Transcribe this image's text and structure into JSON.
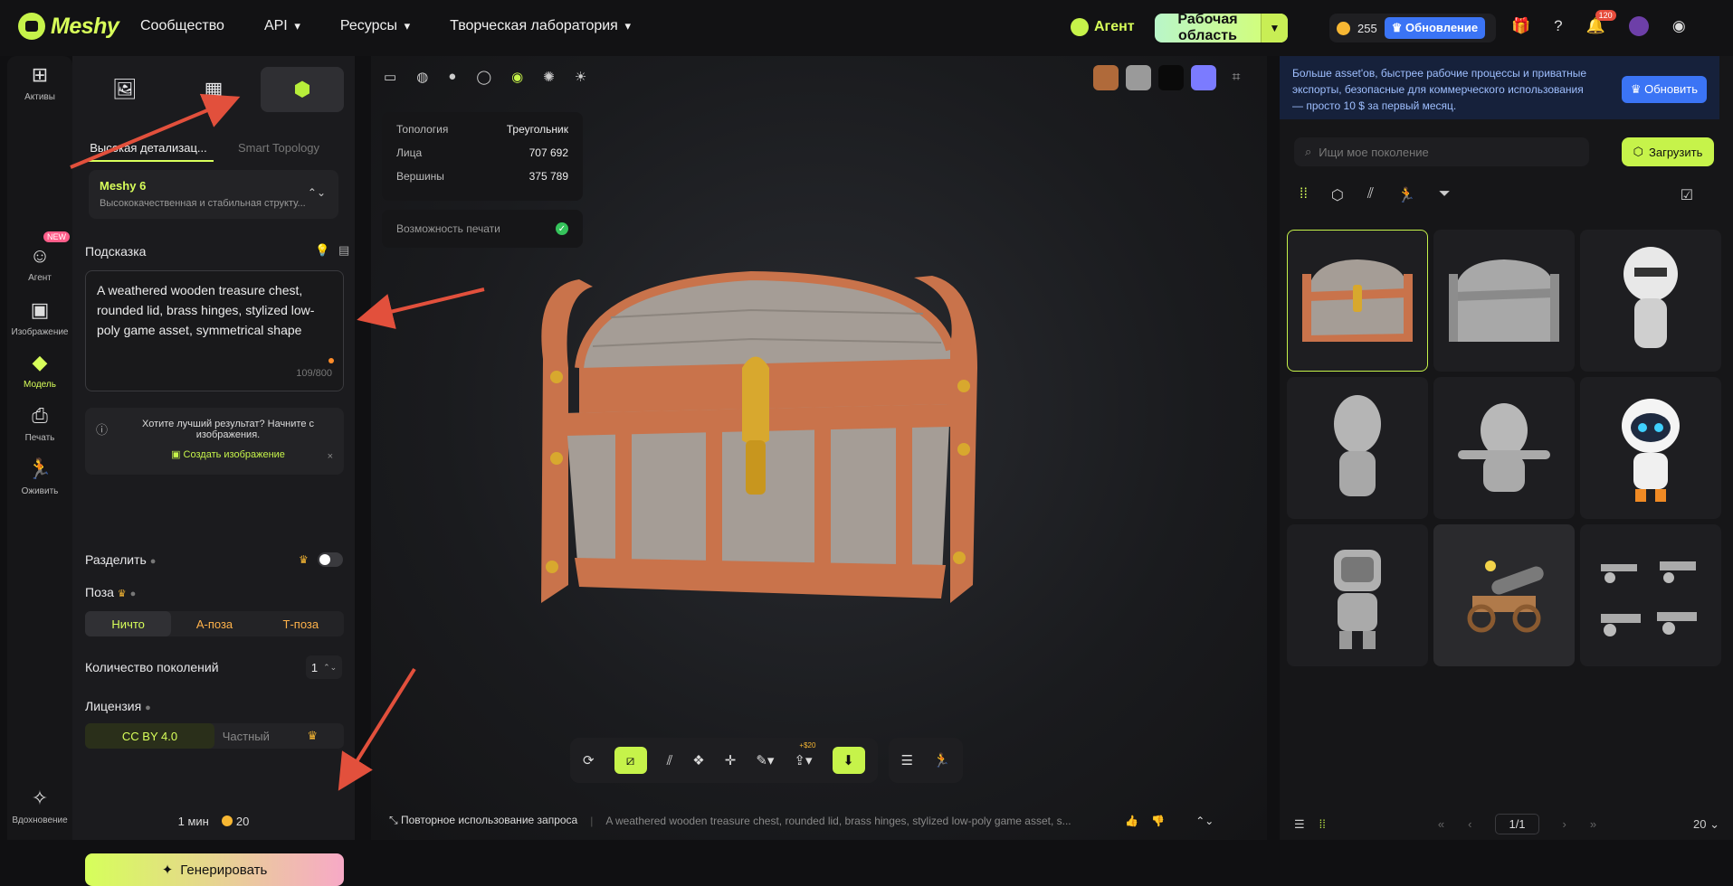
{
  "app": {
    "logo_text": "Meshy"
  },
  "nav": {
    "items": [
      "Сообщество",
      "API",
      "Ресурсы",
      "Творческая лаборатория"
    ]
  },
  "top": {
    "agent_label": "Агент",
    "workspace_label": "Рабочая область",
    "credits": "255",
    "upgrade_label": "Обновление",
    "notif_count": "120"
  },
  "rail": {
    "items": [
      {
        "label": "Активы"
      },
      {
        "label": "Агент",
        "badge": "NEW"
      },
      {
        "label": "Изображение"
      },
      {
        "label": "Модель"
      },
      {
        "label": "Печать"
      },
      {
        "label": "Оживить"
      },
      {
        "label": "Вдохновение"
      }
    ]
  },
  "panel": {
    "segments": [
      "Высокая детализац...",
      "Smart Topology"
    ],
    "model": {
      "name": "Meshy 6",
      "desc": "Высококачественная и стабильная структу..."
    },
    "prompt_label": "Подсказка",
    "prompt_text": "A weathered wooden treasure chest, rounded lid, brass hinges, stylized low-poly game asset, symmetrical shape",
    "prompt_count": "109/800",
    "hint": {
      "text": "Хотите лучший результат? Начните с изображения.",
      "cta": "Создать изображение"
    },
    "split_label": "Разделить",
    "pose_label": "Поза",
    "pose_options": [
      "Ничто",
      "А-поза",
      "Т-поза"
    ],
    "gen_count_label": "Количество поколений",
    "gen_count_value": "1",
    "license_label": "Лицензия",
    "license_options": [
      "CC BY 4.0",
      "Частный"
    ],
    "time": "1 мин",
    "cost": "20",
    "generate_label": "Генерировать"
  },
  "viewer": {
    "info": [
      {
        "k": "Топология",
        "v": "Треугольник"
      },
      {
        "k": "Лица",
        "v": "707 692"
      },
      {
        "k": "Вершины",
        "v": "375 789"
      }
    ],
    "print_label": "Возможность печати",
    "swatch_colors": [
      "#b06a3a",
      "#9a9a9a",
      "#0a0a0a",
      "#7b7bff"
    ],
    "price_tag": "+$20",
    "reuse_label": "Повторное использование запроса",
    "reuse_prompt": "A weathered wooden treasure chest, rounded lid, brass hinges, stylized low-poly game asset, s..."
  },
  "right": {
    "promo_text": "Больше asset'ов, быстрее рабочие процессы и приватные экспорты, безопасные для коммерческого использования — просто 10 $ за первый месяц.",
    "promo_button": "Обновить",
    "search_placeholder": "Ищи мое поколение",
    "upload_label": "Загрузить",
    "page": "1/1",
    "page_size": "20"
  },
  "colors": {
    "accent": "#c6f34a",
    "upgrade": "#3b74f5",
    "wood": "#c9734b",
    "plank": "#a59d96",
    "brass": "#d8a82e"
  }
}
